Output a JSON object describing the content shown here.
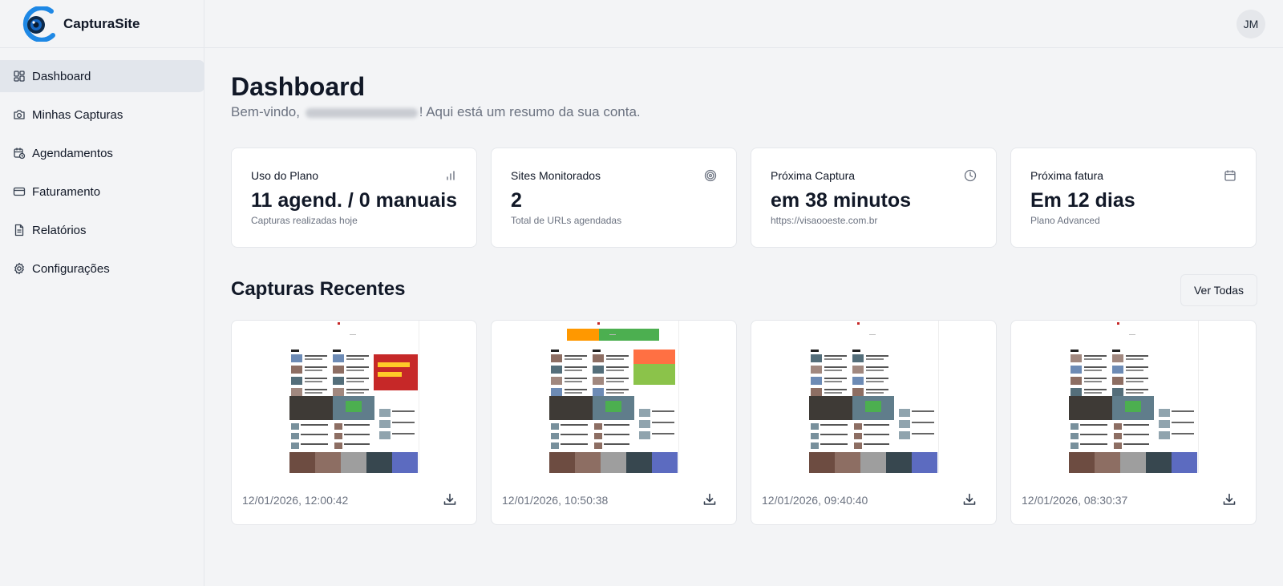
{
  "app": {
    "name": "CapturaSite",
    "avatar_initials": "JM"
  },
  "sidebar": {
    "items": [
      {
        "label": "Dashboard",
        "icon": "dashboard-icon",
        "active": true
      },
      {
        "label": "Minhas Capturas",
        "icon": "camera-icon",
        "active": false
      },
      {
        "label": "Agendamentos",
        "icon": "calendar-clock-icon",
        "active": false
      },
      {
        "label": "Faturamento",
        "icon": "credit-card-icon",
        "active": false
      },
      {
        "label": "Relatórios",
        "icon": "file-text-icon",
        "active": false
      },
      {
        "label": "Configurações",
        "icon": "gear-icon",
        "active": false
      }
    ]
  },
  "page": {
    "title": "Dashboard",
    "welcome_prefix": "Bem-vindo, ",
    "welcome_suffix": "! Aqui está um resumo da sua conta."
  },
  "stats": [
    {
      "label": "Uso do Plano",
      "value": "11 agend. / 0 manuais",
      "sub": "Capturas realizadas hoje",
      "icon": "bar-chart-icon"
    },
    {
      "label": "Sites Monitorados",
      "value": "2",
      "sub": "Total de URLs agendadas",
      "icon": "target-icon"
    },
    {
      "label": "Próxima Captura",
      "value": "em 38 minutos",
      "sub": "https://visaooeste.com.br",
      "icon": "clock-icon"
    },
    {
      "label": "Próxima fatura",
      "value": "Em 12 dias",
      "sub": "Plano Advanced",
      "icon": "calendar-icon"
    }
  ],
  "recent": {
    "title": "Capturas Recentes",
    "view_all_label": "Ver Todas",
    "items": [
      {
        "date": "12/01/2026, 12:00:42"
      },
      {
        "date": "12/01/2026, 10:50:38"
      },
      {
        "date": "12/01/2026, 09:40:40"
      },
      {
        "date": "12/01/2026, 08:30:37"
      }
    ]
  },
  "colors": {
    "background": "#f3f4f6",
    "card": "#ffffff",
    "active_nav": "#e2e6ec",
    "muted_text": "#6b7280",
    "logo_blue": "#1e88e5"
  }
}
